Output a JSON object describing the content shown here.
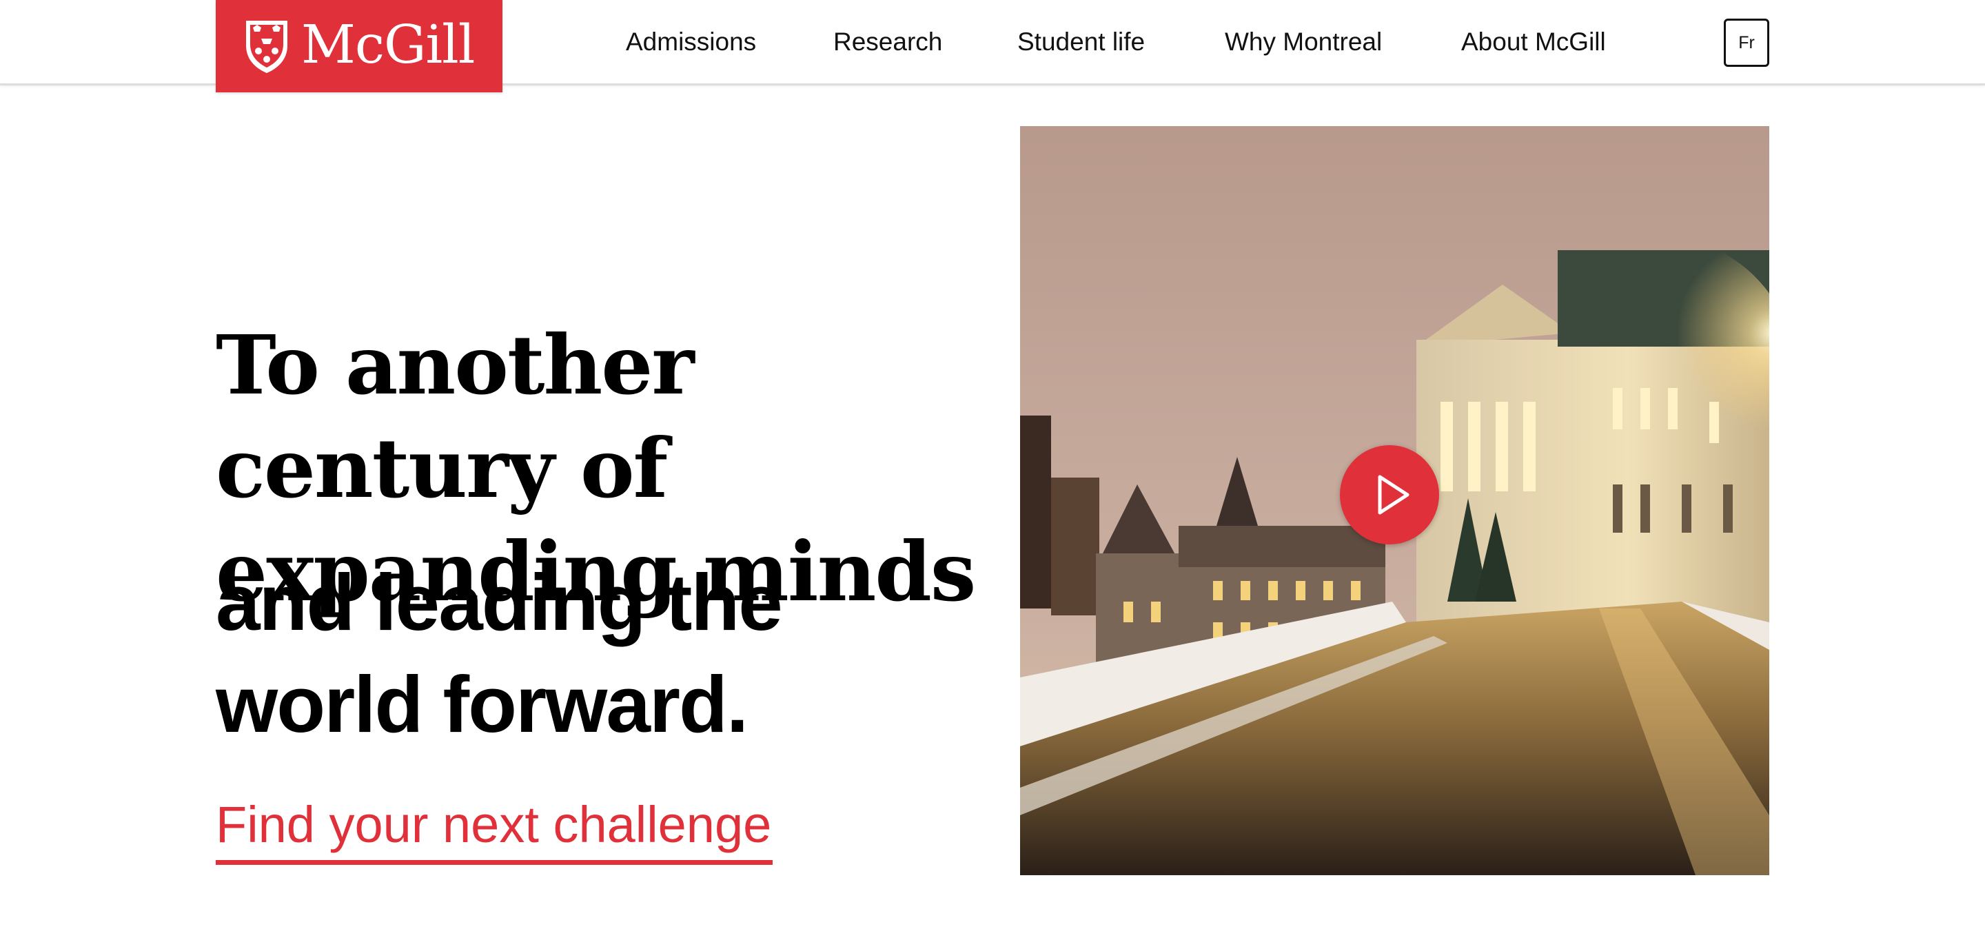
{
  "header": {
    "logo_text": "McGill",
    "nav": [
      {
        "label": "Admissions"
      },
      {
        "label": "Research"
      },
      {
        "label": "Student life"
      },
      {
        "label": "Why Montreal"
      },
      {
        "label": "About McGill"
      }
    ],
    "lang_toggle": "Fr"
  },
  "hero": {
    "headline_serif": "To another century of expanding minds",
    "headline_sans": "and leading the world forward.",
    "cta_label": "Find your next challenge",
    "media": {
      "play_icon": "play-icon",
      "image_description_icon": "campus-night-photo"
    }
  },
  "colors": {
    "brand_red": "#e0313a",
    "text": "#000000",
    "background": "#ffffff"
  }
}
